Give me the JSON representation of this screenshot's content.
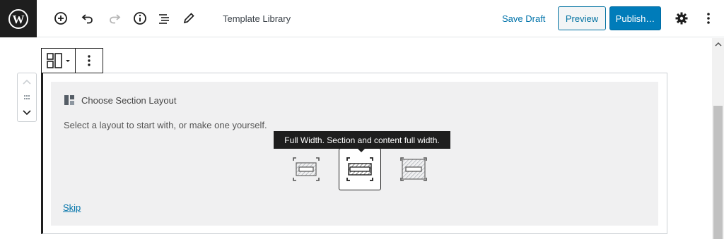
{
  "header": {
    "document_title": "Template Library",
    "save_draft_label": "Save Draft",
    "preview_label": "Preview",
    "publish_label": "Publish…",
    "icons": [
      "wordpress-icon",
      "add-block-icon",
      "undo-icon",
      "redo-icon",
      "info-icon",
      "outline-icon",
      "edit-icon",
      "settings-gear-icon",
      "more-options-icon"
    ]
  },
  "block": {
    "title": "Choose Section Layout",
    "description": "Select a layout to start with, or make one yourself.",
    "tooltip": "Full Width. Section and content full width.",
    "layout_options": [
      "boxed",
      "full-width",
      "full-width-contained"
    ],
    "selected_layout": "full-width",
    "skip_label": "Skip"
  },
  "colors": {
    "accent": "#007cba",
    "link": "#0073aa",
    "dark": "#1e1e1e",
    "placeholder_bg": "#f0f0f1"
  }
}
